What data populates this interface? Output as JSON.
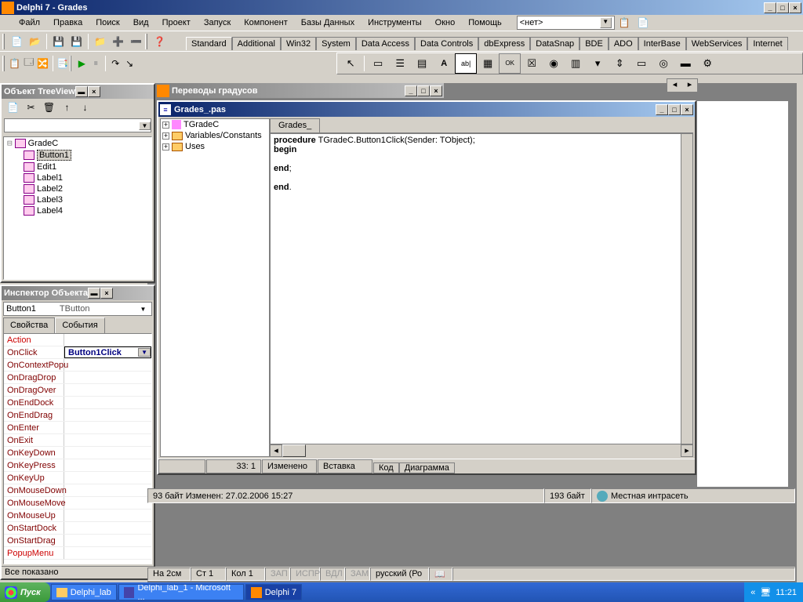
{
  "app": {
    "title": "Delphi 7 - Grades"
  },
  "menu": [
    "Файл",
    "Правка",
    "Поиск",
    "Вид",
    "Проект",
    "Запуск",
    "Компонент",
    "Базы Данных",
    "Инструменты",
    "Окно",
    "Помощь"
  ],
  "combo_none": "<нет>",
  "palette_tabs": [
    "Standard",
    "Additional",
    "Win32",
    "System",
    "Data Access",
    "Data Controls",
    "dbExpress",
    "DataSnap",
    "BDE",
    "ADO",
    "InterBase",
    "WebServices",
    "Internet"
  ],
  "treeview": {
    "title": "Объект TreeView",
    "root": "GradeC",
    "children": [
      "Button1",
      "Edit1",
      "Label1",
      "Label2",
      "Label3",
      "Label4"
    ]
  },
  "inspector": {
    "title": "Инспектор Объекта",
    "object": "Button1",
    "class": "TButton",
    "tabs": [
      "Свойства",
      "События"
    ],
    "active_tab": 1,
    "events": [
      {
        "name": "Action",
        "val": "",
        "red": true
      },
      {
        "name": "OnClick",
        "val": "Button1Click",
        "sel": true
      },
      {
        "name": "OnContextPopu",
        "val": ""
      },
      {
        "name": "OnDragDrop",
        "val": ""
      },
      {
        "name": "OnDragOver",
        "val": ""
      },
      {
        "name": "OnEndDock",
        "val": ""
      },
      {
        "name": "OnEndDrag",
        "val": ""
      },
      {
        "name": "OnEnter",
        "val": ""
      },
      {
        "name": "OnExit",
        "val": ""
      },
      {
        "name": "OnKeyDown",
        "val": ""
      },
      {
        "name": "OnKeyPress",
        "val": ""
      },
      {
        "name": "OnKeyUp",
        "val": ""
      },
      {
        "name": "OnMouseDown",
        "val": ""
      },
      {
        "name": "OnMouseMove",
        "val": ""
      },
      {
        "name": "OnMouseUp",
        "val": ""
      },
      {
        "name": "OnStartDock",
        "val": ""
      },
      {
        "name": "OnStartDrag",
        "val": ""
      },
      {
        "name": "PopupMenu",
        "val": "",
        "red": true
      }
    ],
    "status": "Все показано"
  },
  "form_window": {
    "title": "Переводы градусов"
  },
  "code_window": {
    "title": "Grades_.pas",
    "tab": "Grades_",
    "tree": [
      "TGradeC",
      "Variables/Constants",
      "Uses"
    ],
    "code_lines": [
      {
        "t": "procedure",
        "rest": " TGradeC.Button1Click(Sender: TObject);"
      },
      {
        "t": "begin",
        "rest": ""
      },
      {
        "t": "",
        "rest": ""
      },
      {
        "t": "end",
        "rest": ";"
      },
      {
        "t": "",
        "rest": ""
      },
      {
        "t": "end",
        "rest": "."
      }
    ],
    "status": {
      "pos": "33: 1",
      "modified": "Изменено",
      "insert": "Вставка",
      "views": [
        "Код",
        "Диаграмма"
      ]
    }
  },
  "bottom_status": {
    "left": "93 байт Изменен: 27.02.2006 15:27",
    "mid": "193 байт",
    "right": "Местная интрасеть"
  },
  "editor_status": {
    "ch": "На  2см",
    "ln": "Ст  1",
    "col": "Кол  1",
    "zap": "ЗАП",
    "ispr": "ИСПР",
    "vdl": "ВДЛ",
    "zam": "ЗАМ",
    "lang": "русский (Ро"
  },
  "taskbar": {
    "start": "Пуск",
    "items": [
      "Delphi_lab",
      "Delphi_lab_1 - Microsoft ...",
      "Delphi 7"
    ],
    "time": "11:21"
  }
}
